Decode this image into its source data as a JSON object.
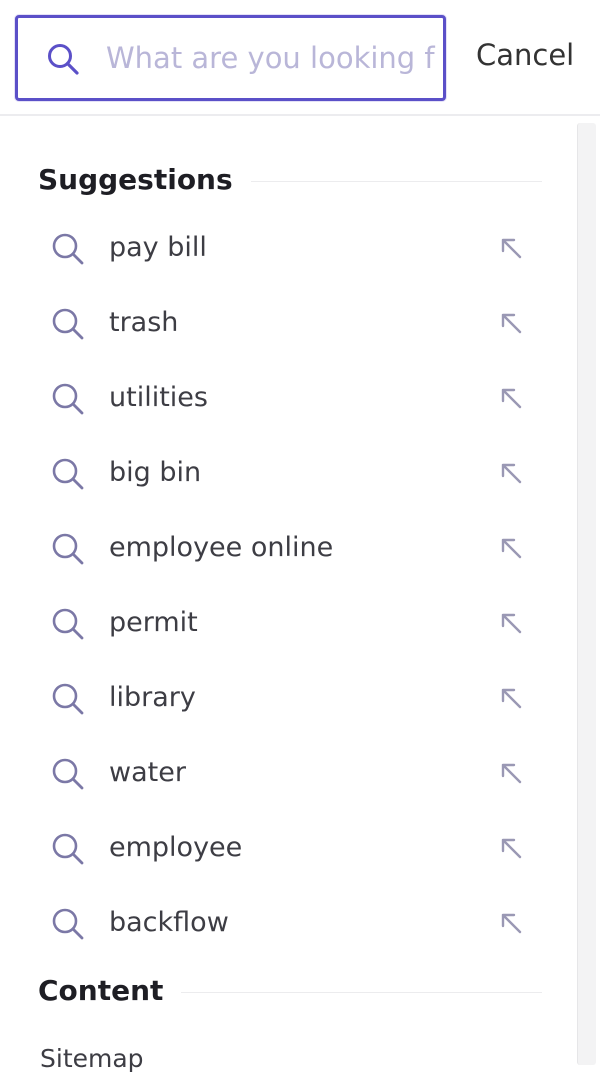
{
  "search": {
    "placeholder": "What are you looking for?",
    "value": "",
    "cancel_label": "Cancel"
  },
  "suggestions": {
    "title": "Suggestions",
    "items": [
      {
        "label": "pay bill"
      },
      {
        "label": "trash"
      },
      {
        "label": "utilities"
      },
      {
        "label": "big bin"
      },
      {
        "label": "employee online"
      },
      {
        "label": "permit"
      },
      {
        "label": "library"
      },
      {
        "label": "water"
      },
      {
        "label": "employee"
      },
      {
        "label": "backflow"
      }
    ]
  },
  "content": {
    "title": "Content",
    "items": [
      {
        "label": "Sitemap"
      }
    ]
  },
  "colors": {
    "accent": "#5b50c8",
    "icon": "#7b78a6",
    "arrow": "#9a98b4"
  }
}
